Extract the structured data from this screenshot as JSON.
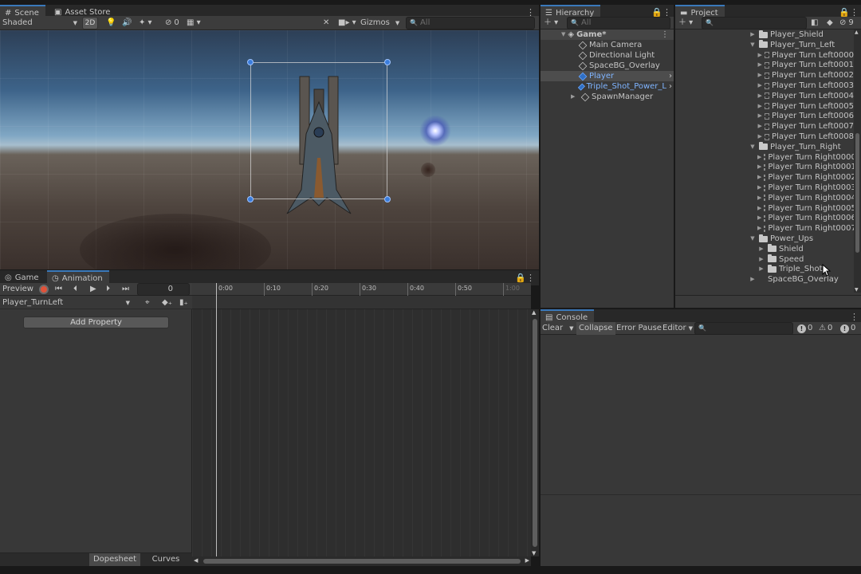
{
  "scene": {
    "tabs": [
      "Scene",
      "Asset Store"
    ],
    "shading_mode": "Shaded",
    "mode_2d": "2D",
    "hidden_count": "0",
    "gizmos": "Gizmos",
    "search_placeholder": "All"
  },
  "hierarchy": {
    "tab": "Hierarchy",
    "search_placeholder": "All",
    "root": "Game*",
    "items": [
      {
        "label": "Main Camera",
        "icon": "cube-icon"
      },
      {
        "label": "Directional Light",
        "icon": "cube-icon"
      },
      {
        "label": "SpaceBG_Overlay",
        "icon": "cube-icon"
      },
      {
        "label": "Player",
        "icon": "prefab-cube-icon",
        "selected": true
      },
      {
        "label": "Triple_Shot_Power_L",
        "icon": "prefab-cube-icon"
      },
      {
        "label": "SpawnManager",
        "icon": "cube-icon"
      }
    ]
  },
  "project": {
    "tab": "Project",
    "hidden_count": "9",
    "tree": [
      {
        "label": "Player_Shield",
        "type": "folder",
        "level": 0,
        "expanded": false
      },
      {
        "label": "Player_Turn_Left",
        "type": "folder",
        "level": 0,
        "expanded": true
      },
      {
        "label": "Player Turn Left0000",
        "type": "sprite",
        "level": 1
      },
      {
        "label": "Player Turn Left0001",
        "type": "sprite",
        "level": 1
      },
      {
        "label": "Player Turn Left0002",
        "type": "sprite",
        "level": 1
      },
      {
        "label": "Player Turn Left0003",
        "type": "sprite",
        "level": 1
      },
      {
        "label": "Player Turn Left0004",
        "type": "sprite",
        "level": 1
      },
      {
        "label": "Player Turn Left0005",
        "type": "sprite",
        "level": 1
      },
      {
        "label": "Player Turn Left0006",
        "type": "sprite",
        "level": 1
      },
      {
        "label": "Player Turn Left0007",
        "type": "sprite",
        "level": 1
      },
      {
        "label": "Player Turn Left0008",
        "type": "sprite",
        "level": 1
      },
      {
        "label": "Player_Turn_Right",
        "type": "folder",
        "level": 0,
        "expanded": true
      },
      {
        "label": "Player Turn Right0000",
        "type": "sprite",
        "level": 1
      },
      {
        "label": "Player Turn Right0001",
        "type": "sprite",
        "level": 1
      },
      {
        "label": "Player Turn Right0002",
        "type": "sprite",
        "level": 1
      },
      {
        "label": "Player Turn Right0003",
        "type": "sprite",
        "level": 1
      },
      {
        "label": "Player Turn Right0004",
        "type": "sprite",
        "level": 1
      },
      {
        "label": "Player Turn Right0005",
        "type": "sprite",
        "level": 1
      },
      {
        "label": "Player Turn Right0006",
        "type": "sprite",
        "level": 1
      },
      {
        "label": "Player Turn Right0007",
        "type": "sprite",
        "level": 1
      },
      {
        "label": "Power_Ups",
        "type": "folder",
        "level": 0,
        "expanded": true
      },
      {
        "label": "Shield",
        "type": "folder",
        "level": 1,
        "expanded": false
      },
      {
        "label": "Speed",
        "type": "folder",
        "level": 1,
        "expanded": false
      },
      {
        "label": "Triple_Shot",
        "type": "folder",
        "level": 1,
        "expanded": false
      },
      {
        "label": "SpaceBG_Overlay",
        "type": "sprite",
        "level": 0
      }
    ]
  },
  "animation": {
    "tabs": [
      "Game",
      "Animation"
    ],
    "preview": "Preview",
    "frame": "0",
    "clip": "Player_TurnLeft",
    "add_property": "Add Property",
    "ruler": [
      "0:00",
      "0:10",
      "0:20",
      "0:30",
      "0:40",
      "0:50",
      "1:00"
    ],
    "bottom_tabs": [
      "Dopesheet",
      "Curves"
    ]
  },
  "console": {
    "tab": "Console",
    "clear": "Clear",
    "collapse": "Collapse",
    "error_pause": "Error Pause",
    "editor": "Editor",
    "log_count": "0",
    "warning_count": "0",
    "error_count": "0"
  },
  "colors": {
    "accent": "#3a79bb",
    "selection": "#4d4d4d",
    "record": "#e0533a"
  }
}
